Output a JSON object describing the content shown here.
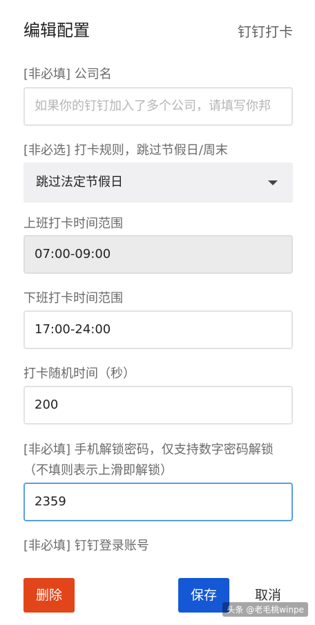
{
  "header": {
    "title": "编辑配置",
    "app_name": "钉钉打卡"
  },
  "fields": {
    "company": {
      "label": "[非必填] 公司名",
      "placeholder": "如果你的钉钉加入了多个公司，请填写你邦"
    },
    "rule": {
      "label": "[非必选] 打卡规则，跳过节假日/周末",
      "value": "跳过法定节假日"
    },
    "work_start": {
      "label": "上班打卡时间范围",
      "value": "07:00-09:00"
    },
    "work_end": {
      "label": "下班打卡时间范围",
      "value": "17:00-24:00"
    },
    "random_time": {
      "label": "打卡随机时间（秒）",
      "value": "200"
    },
    "unlock_password": {
      "label": "[非必填] 手机解锁密码，仅支持数字密码解锁（不填则表示上滑即解锁）",
      "value": "2359"
    },
    "account": {
      "label": "[非必填] 钉钉登录账号"
    }
  },
  "buttons": {
    "delete": "删除",
    "save": "保存",
    "cancel": "取消"
  },
  "watermark": "头条 @老毛桃winpe",
  "colors": {
    "delete": "#e2451a",
    "save": "#1558d6",
    "focus_border": "#5a9de6"
  },
  "icons": {
    "select_caret": "caret-down-icon"
  }
}
